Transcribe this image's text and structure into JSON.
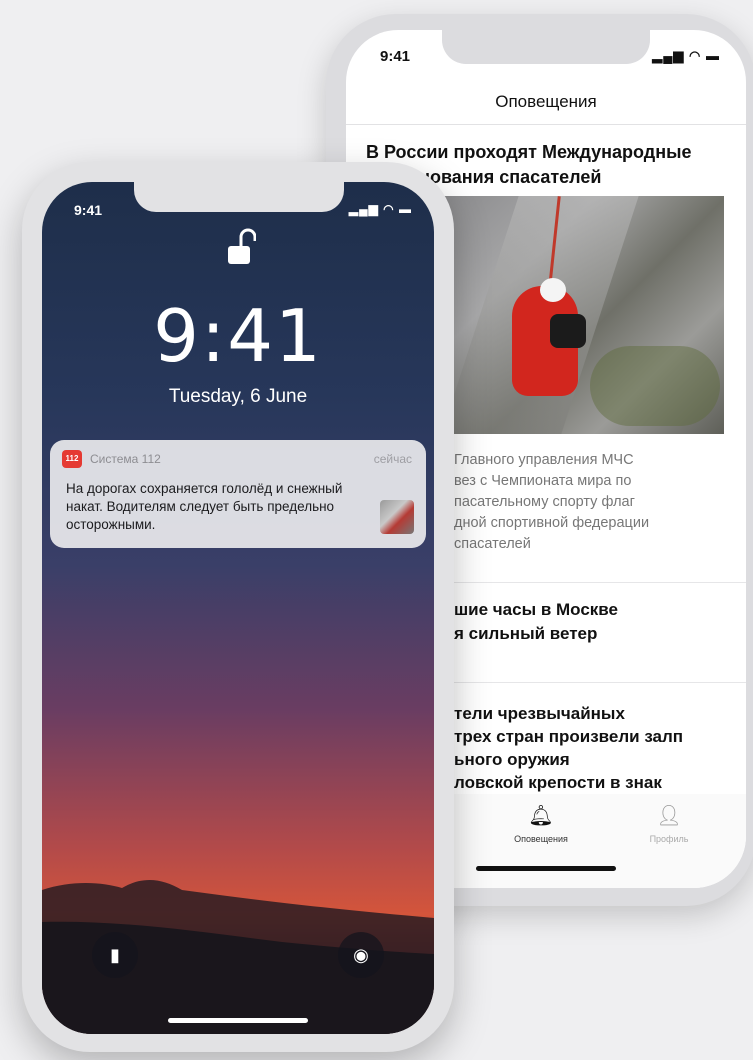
{
  "news_app": {
    "status_time": "9:41",
    "status_icons": "signal-wifi-battery",
    "header_title": "Оповещения",
    "feed": [
      {
        "title": "В России проходят Международные соревнования спасателей",
        "title_visible": "В России проходят Международные\n…ования спасателей",
        "body": "Главного управления МЧС\nвез с Чемпионата мира по\nпасательному спорту флаг\nдной спортивной федерации\nспасателей"
      },
      {
        "title": "шие часы в Москве\nя сильный ветер"
      },
      {
        "title": "тели чрезвычайных\nтрех стран произвели залп\nьного оружия\nловской крепости в знак"
      }
    ],
    "tabs": [
      {
        "label": "Оповещения",
        "icon": "bell-icon",
        "active": true
      },
      {
        "label": "Профиль",
        "icon": "person-icon",
        "active": false
      }
    ]
  },
  "lock_screen": {
    "status_time": "9:41",
    "clock": "9:41",
    "date": "Tuesday, 6 June",
    "notification": {
      "app_badge": "112",
      "app_name": "Система 112",
      "time": "сейчас",
      "text": "На дорогах сохраняется гололёд и снежный накат. Водителям следует быть предельно осторожными."
    },
    "quick_actions": [
      {
        "icon": "flashlight-icon",
        "glyph": "▮"
      },
      {
        "icon": "camera-icon",
        "glyph": "◉"
      }
    ]
  },
  "colors": {
    "badge_red": "#e53a33",
    "page_bg": "#efeff1",
    "sky_top": "#1e2e4a",
    "sunset": "#d4553b"
  }
}
